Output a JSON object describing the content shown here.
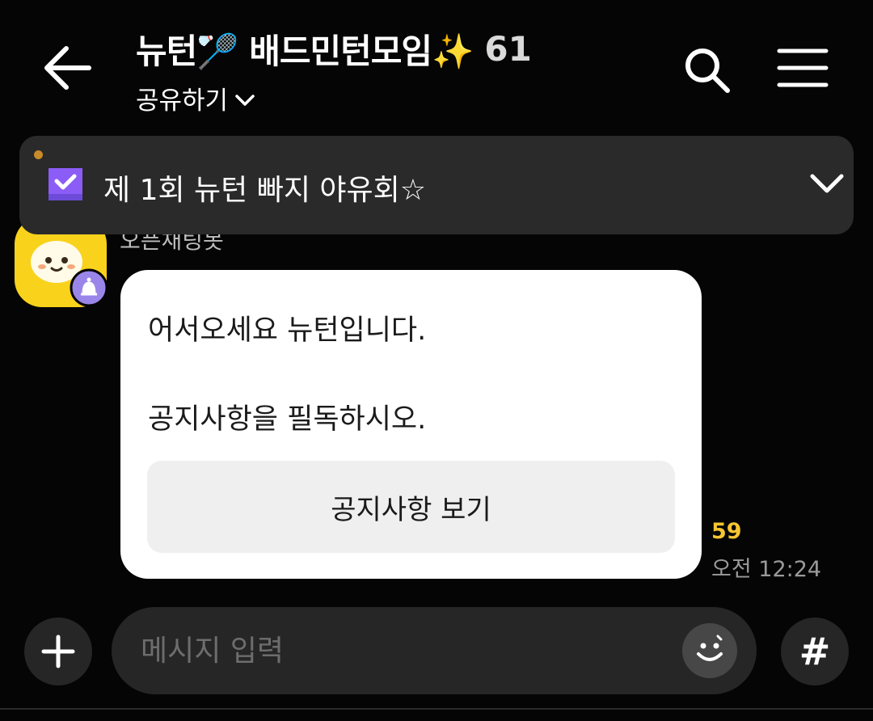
{
  "header": {
    "title": "뉴턴🏸 배드민턴모임✨",
    "member_count": "61",
    "subtitle": "공유하기"
  },
  "icons": {
    "back": "arrow-left-icon",
    "search": "search-icon",
    "menu": "hamburger-menu-icon",
    "notice": "checkbox-notice-icon",
    "expand": "chevron-down-icon",
    "add": "plus-icon",
    "emoji": "smiley-icon",
    "hashtag": "hashtag-icon"
  },
  "notice_banner": {
    "text": "제 1회 뉴턴 빠지 야유회☆"
  },
  "message": {
    "sender": "오픈채팅봇",
    "line1": "어서오세요 뉴턴입니다.",
    "line2": "공지사항을 필독하시오.",
    "button_label": "공지사항 보기",
    "unread": "59",
    "time": "오전 12:24"
  },
  "input": {
    "placeholder": "메시지 입력",
    "hash_label": "#"
  },
  "colors": {
    "background": "#050505",
    "banner": "#2a2a2a",
    "accent_yellow": "#f7c531",
    "notice_purple": "#8b5cf6"
  }
}
